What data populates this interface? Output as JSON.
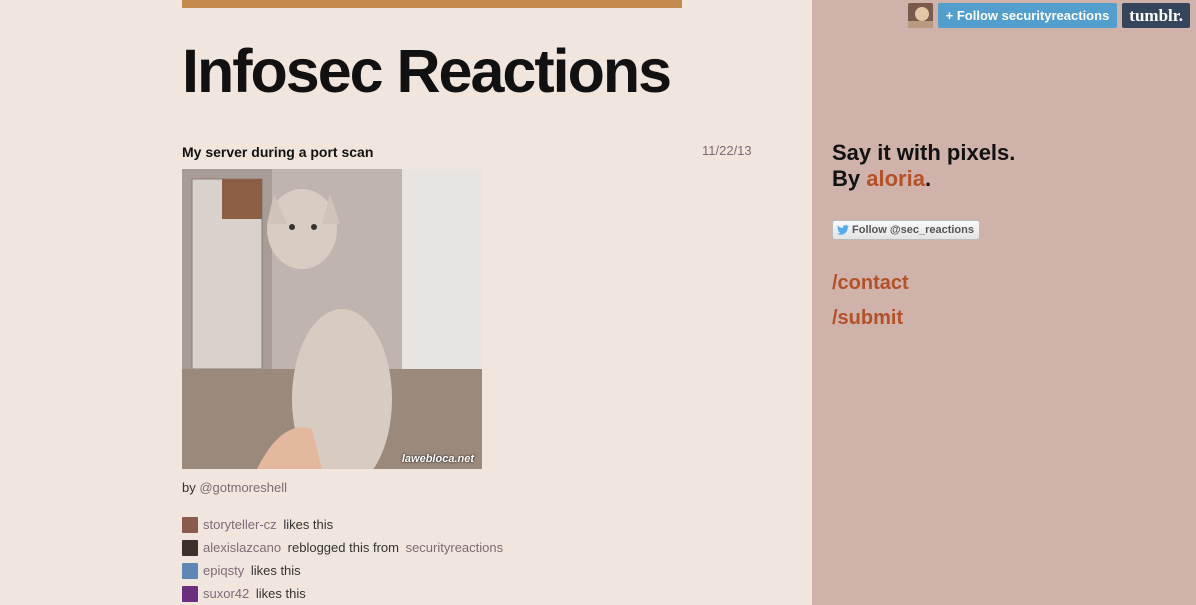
{
  "header": {
    "blog_title": "Infosec Reactions"
  },
  "post": {
    "title": "My server during a port scan",
    "date": "11/22/13",
    "image_watermark": "lawebloca.net",
    "byline_prefix": "by",
    "byline_author": "@gotmoreshell"
  },
  "notes": [
    {
      "user": "storyteller-cz",
      "action": "likes this",
      "from_label": "",
      "from_user": "",
      "avatar_color": "#8a5b4c"
    },
    {
      "user": "alexislazcano",
      "action": "reblogged this from",
      "from_label": "",
      "from_user": "securityreactions",
      "avatar_color": "#3d2f2a"
    },
    {
      "user": "epiqsty",
      "action": "likes this",
      "from_label": "",
      "from_user": "",
      "avatar_color": "#5e87b8"
    },
    {
      "user": "suxor42",
      "action": "likes this",
      "from_label": "",
      "from_user": "",
      "avatar_color": "#6b2f7d"
    }
  ],
  "sidebar": {
    "tagline_line1": "Say it with pixels.",
    "tagline_by": "By",
    "tagline_author": "aloria",
    "tagline_period": ".",
    "twitter_label": "Follow @sec_reactions",
    "links": [
      "/contact",
      "/submit"
    ]
  },
  "tumblr_controls": {
    "follow_label": "+ Follow securityreactions",
    "logo_text": "tumblr."
  },
  "colors": {
    "background": "#f1e6dd",
    "sidebar": "#cfb2aa",
    "accent": "#c58a4e",
    "link": "#b4512a",
    "follow_button": "#529ecc",
    "tumblr_logo": "#35465c"
  }
}
